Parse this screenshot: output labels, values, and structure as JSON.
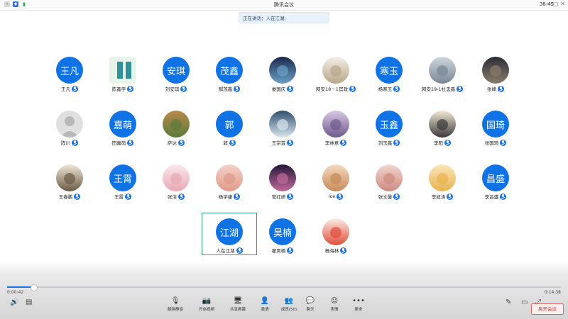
{
  "titlebar": {
    "app_title": "腾讯会议",
    "clock": "38:45",
    "icons": [
      "back-icon",
      "shield-icon",
      "signal-icon"
    ],
    "window_buttons": [
      "─",
      "□",
      "✕"
    ]
  },
  "speaking_banner": "正在讲话：人在江湖;",
  "participants": [
    [
      {
        "name": "王凡",
        "avatar_text": "王凡",
        "avatar_type": "text"
      },
      {
        "name": "陈鑫宇",
        "avatar_type": "image",
        "icon": "qr-code-icon"
      },
      {
        "name": "刘安琪",
        "avatar_text": "安琪",
        "avatar_type": "text"
      },
      {
        "name": "郝茂鑫",
        "avatar_text": "茂鑫",
        "avatar_type": "text"
      },
      {
        "name": "娄国庆",
        "avatar_type": "image",
        "icon": "landscape-photo-icon"
      },
      {
        "name": "网安18－1官政",
        "avatar_type": "image",
        "icon": "cartoon-figure-icon"
      },
      {
        "name": "杨寒玉",
        "avatar_text": "寒玉",
        "avatar_type": "text"
      },
      {
        "name": "网安19-1杜忠鑫",
        "avatar_type": "image",
        "icon": "photo-icon"
      },
      {
        "name": "张峰",
        "avatar_type": "image",
        "icon": "person-photo-icon"
      }
    ],
    [
      {
        "name": "陈川",
        "avatar_type": "default",
        "icon": "default-user-icon"
      },
      {
        "name": "田嘉萌",
        "avatar_text": "嘉萌",
        "avatar_type": "text"
      },
      {
        "name": "萨达",
        "avatar_type": "image",
        "icon": "tiger-photo-icon"
      },
      {
        "name": "郭",
        "avatar_text": "郭",
        "avatar_type": "text"
      },
      {
        "name": "王宗首",
        "avatar_type": "image",
        "icon": "bird-photo-icon"
      },
      {
        "name": "李林意",
        "avatar_type": "image",
        "icon": "anime-photo-icon"
      },
      {
        "name": "刘玉鑫",
        "avatar_text": "玉鑫",
        "avatar_type": "text"
      },
      {
        "name": "李阳",
        "avatar_type": "image",
        "icon": "penguin-photo-icon"
      },
      {
        "name": "张国琦",
        "avatar_text": "国琦",
        "avatar_type": "text"
      }
    ],
    [
      {
        "name": "王春鹏",
        "avatar_type": "image",
        "icon": "sketch-photo-icon"
      },
      {
        "name": "王霄",
        "avatar_text": "王霄",
        "avatar_type": "text"
      },
      {
        "name": "张洁",
        "avatar_type": "image",
        "icon": "cartoon-photo-icon"
      },
      {
        "name": "杨学康",
        "avatar_type": "image",
        "icon": "pig-photo-icon"
      },
      {
        "name": "管红妍",
        "avatar_type": "image",
        "icon": "sunset-photo-icon"
      },
      {
        "name": "Ice",
        "avatar_type": "image",
        "icon": "girl-photo-icon"
      },
      {
        "name": "张文馨",
        "avatar_type": "image",
        "icon": "pet-photo-icon"
      },
      {
        "name": "李旭涛",
        "avatar_type": "image",
        "icon": "rabbit-photo-icon"
      },
      {
        "name": "李昌盛",
        "avatar_text": "昌盛",
        "avatar_type": "text"
      }
    ],
    [
      {
        "name": "人在江湖",
        "avatar_text": "江湖",
        "avatar_type": "text",
        "selected": true
      },
      {
        "name": "翟昊楠",
        "avatar_text": "昊楠",
        "avatar_type": "text"
      },
      {
        "name": "杨海林",
        "avatar_type": "image",
        "icon": "cartoon-girl-icon"
      }
    ]
  ],
  "playback": {
    "elapsed": "0:00:42",
    "total": "0:14:38",
    "progress": 0.048
  },
  "toolbar": [
    {
      "label": "解除静音",
      "icon": "mic-muted-icon"
    },
    {
      "label": "开启视频",
      "icon": "camera-off-icon"
    },
    {
      "label": "共享屏幕",
      "icon": "share-screen-icon"
    },
    {
      "label": "邀请",
      "icon": "invite-icon"
    },
    {
      "label": "成员(50)",
      "icon": "members-icon"
    },
    {
      "label": "聊天",
      "icon": "chat-icon"
    },
    {
      "label": "表情",
      "icon": "emoji-icon"
    },
    {
      "label": "更多",
      "icon": "more-icon"
    }
  ],
  "leave_button": "离开会议",
  "colors": {
    "accent": "#1a74e8",
    "avatar_blue": "#0f73e6",
    "selected_border": "#2aa36a",
    "leave": "#c83c3c"
  }
}
